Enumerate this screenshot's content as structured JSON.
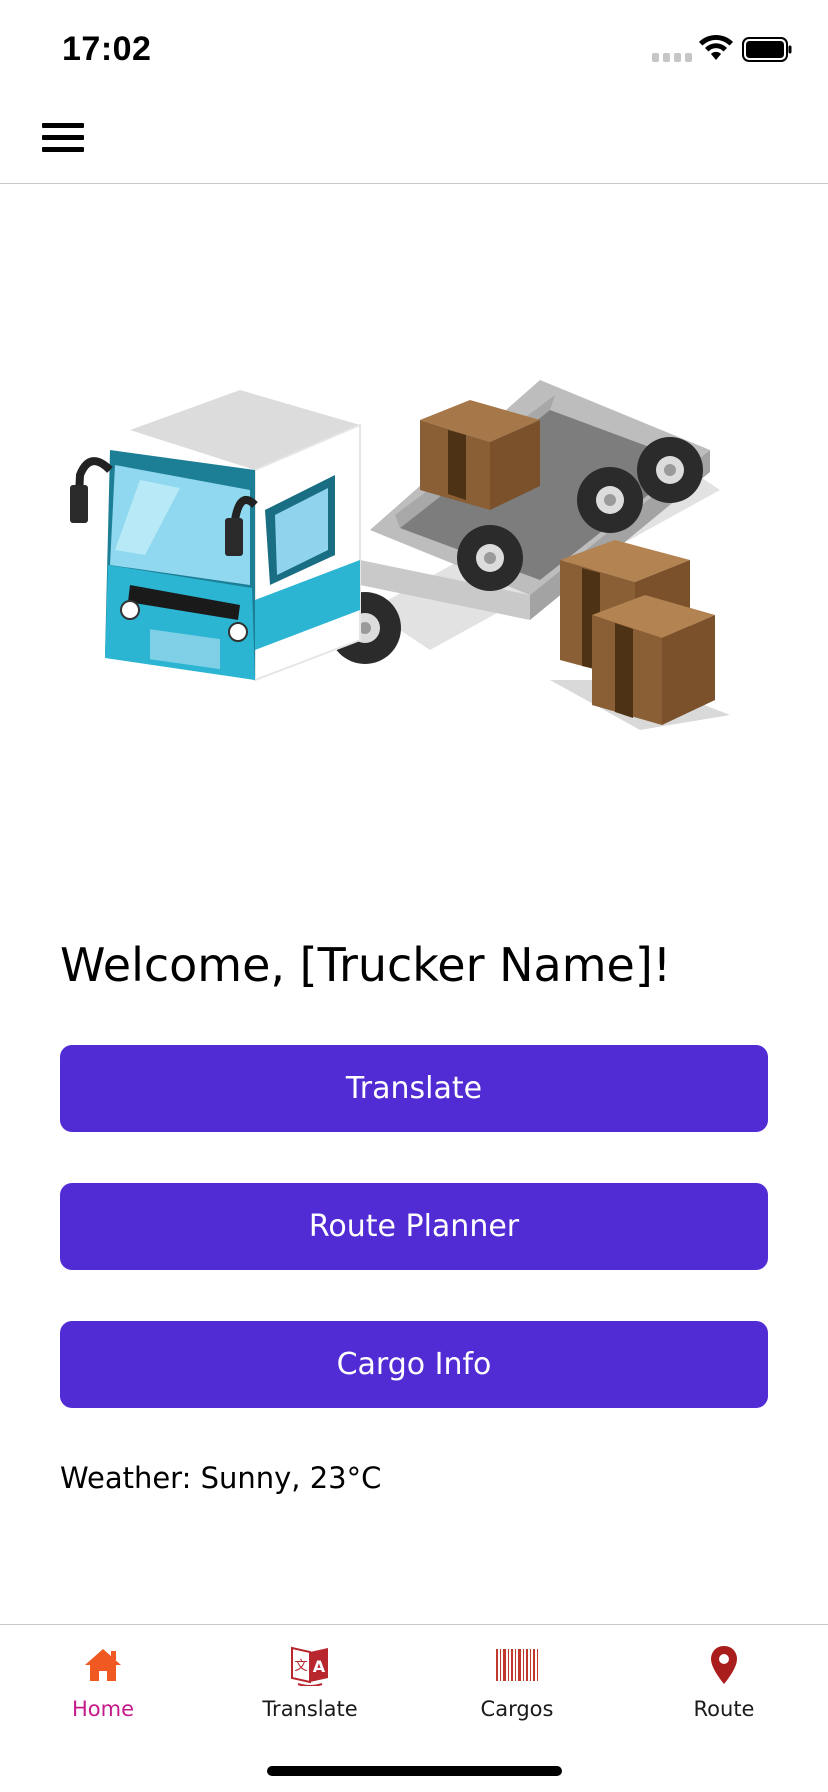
{
  "status_bar": {
    "time": "17:02"
  },
  "app_bar": {
    "menu_icon": "hamburger-menu-icon"
  },
  "hero": {
    "image": "truck-with-cargo-boxes-illustration"
  },
  "main": {
    "welcome_text": "Welcome, [Trucker Name]!",
    "buttons": [
      {
        "label": "Translate"
      },
      {
        "label": "Route Planner"
      },
      {
        "label": "Cargo Info"
      }
    ],
    "weather_text": "Weather: Sunny, 23°C",
    "button_color": "#512bd4"
  },
  "tab_bar": {
    "active_color": "#c51b8a",
    "tabs": [
      {
        "label": "Home",
        "icon": "home-icon",
        "active": true
      },
      {
        "label": "Translate",
        "icon": "translate-icon",
        "active": false
      },
      {
        "label": "Cargos",
        "icon": "barcode-icon",
        "active": false
      },
      {
        "label": "Route",
        "icon": "map-pin-icon",
        "active": false
      }
    ]
  }
}
